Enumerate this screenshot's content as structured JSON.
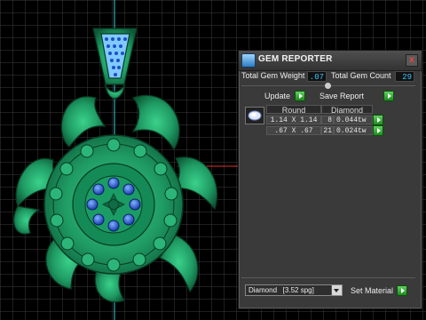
{
  "window": {
    "title": "GEM REPORTER",
    "close_glyph": "x"
  },
  "totals": {
    "weight_label": "Total Gem Weight",
    "weight_value": ".07",
    "count_label": "Total Gem Count",
    "count_value": "29"
  },
  "actions": {
    "update_label": "Update",
    "save_label": "Save Report"
  },
  "table": {
    "shape_header": "Round",
    "type_header": "Diamond",
    "rows": [
      {
        "size": "1.14 X 1.14",
        "count": "8",
        "weight": "0.044tw"
      },
      {
        "size": ".67 X .67",
        "count": "21",
        "weight": "0.024tw"
      }
    ]
  },
  "material": {
    "selected": "Diamond   [3.52 spg]",
    "set_label": "Set Material"
  },
  "colors": {
    "accent_blue": "#39c8ff",
    "go_green": "#2db52d",
    "model_green": "#1f9a63",
    "gem_blue": "#1e55d8"
  },
  "icons": {
    "window_icon": "gem-reporter-app-icon",
    "go": "play-arrow-icon",
    "thumbnail": "round-gem-icon",
    "dropdown": "chevron-down-icon"
  }
}
